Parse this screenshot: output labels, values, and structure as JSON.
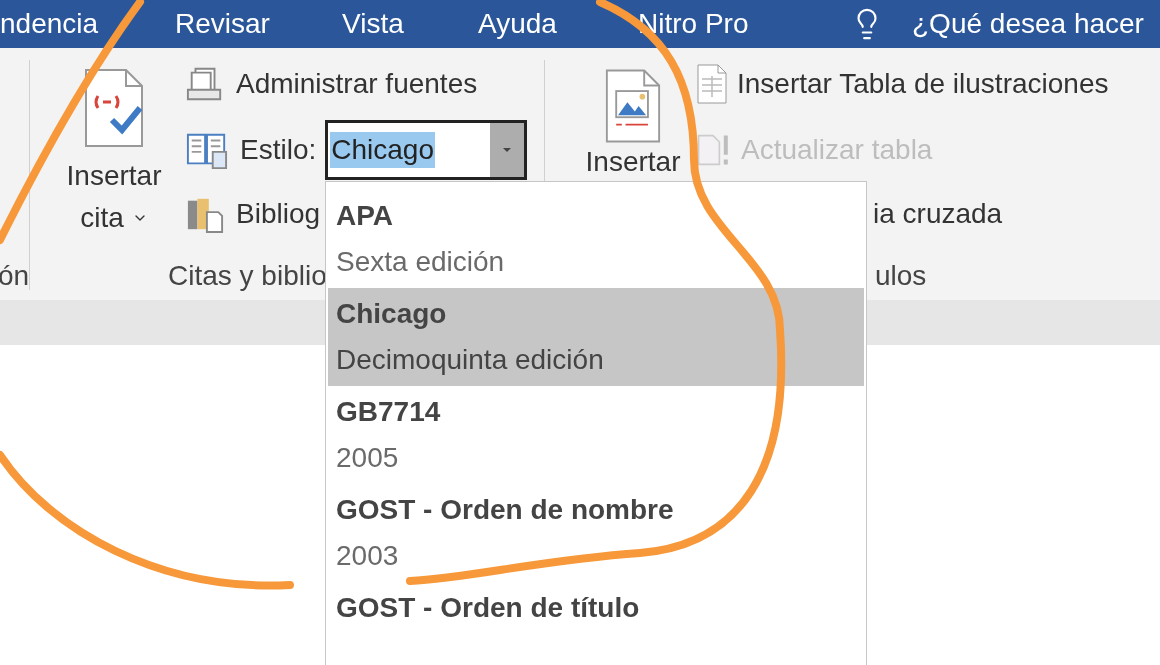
{
  "menu_bar": {
    "items": [
      "ndencia",
      "Revisar",
      "Vista",
      "Ayuda",
      "Nitro Pro"
    ],
    "search_prompt": "¿Qué desea hacer"
  },
  "ribbon": {
    "left_group_label": "ón",
    "citations_group": {
      "insert_citation": {
        "line1": "Insertar",
        "line2": "cita"
      },
      "manage_sources": "Administrar fuentes",
      "style_label": "Estilo:",
      "style_value": "Chicago",
      "bibliography": "Bibliog",
      "label": "Citas y biblio"
    },
    "captions_group": {
      "insert_caption": "Insertar",
      "insert_table_of_figures": "Insertar Tabla de ilustraciones",
      "update_table": {
        "label": "Actualizar tabla",
        "disabled": true
      },
      "cross_reference": "ia cruzada",
      "label": "ulos"
    }
  },
  "style_dropdown": {
    "items": [
      {
        "name": "APA",
        "edition": "Sexta edición",
        "selected": false
      },
      {
        "name": "Chicago",
        "edition": "Decimoquinta edición",
        "selected": true
      },
      {
        "name": "GB7714",
        "edition": "2005",
        "selected": false
      },
      {
        "name": "GOST - Orden de nombre",
        "edition": "2003",
        "selected": false
      },
      {
        "name": "GOST - Orden de título",
        "selected": false
      }
    ]
  }
}
